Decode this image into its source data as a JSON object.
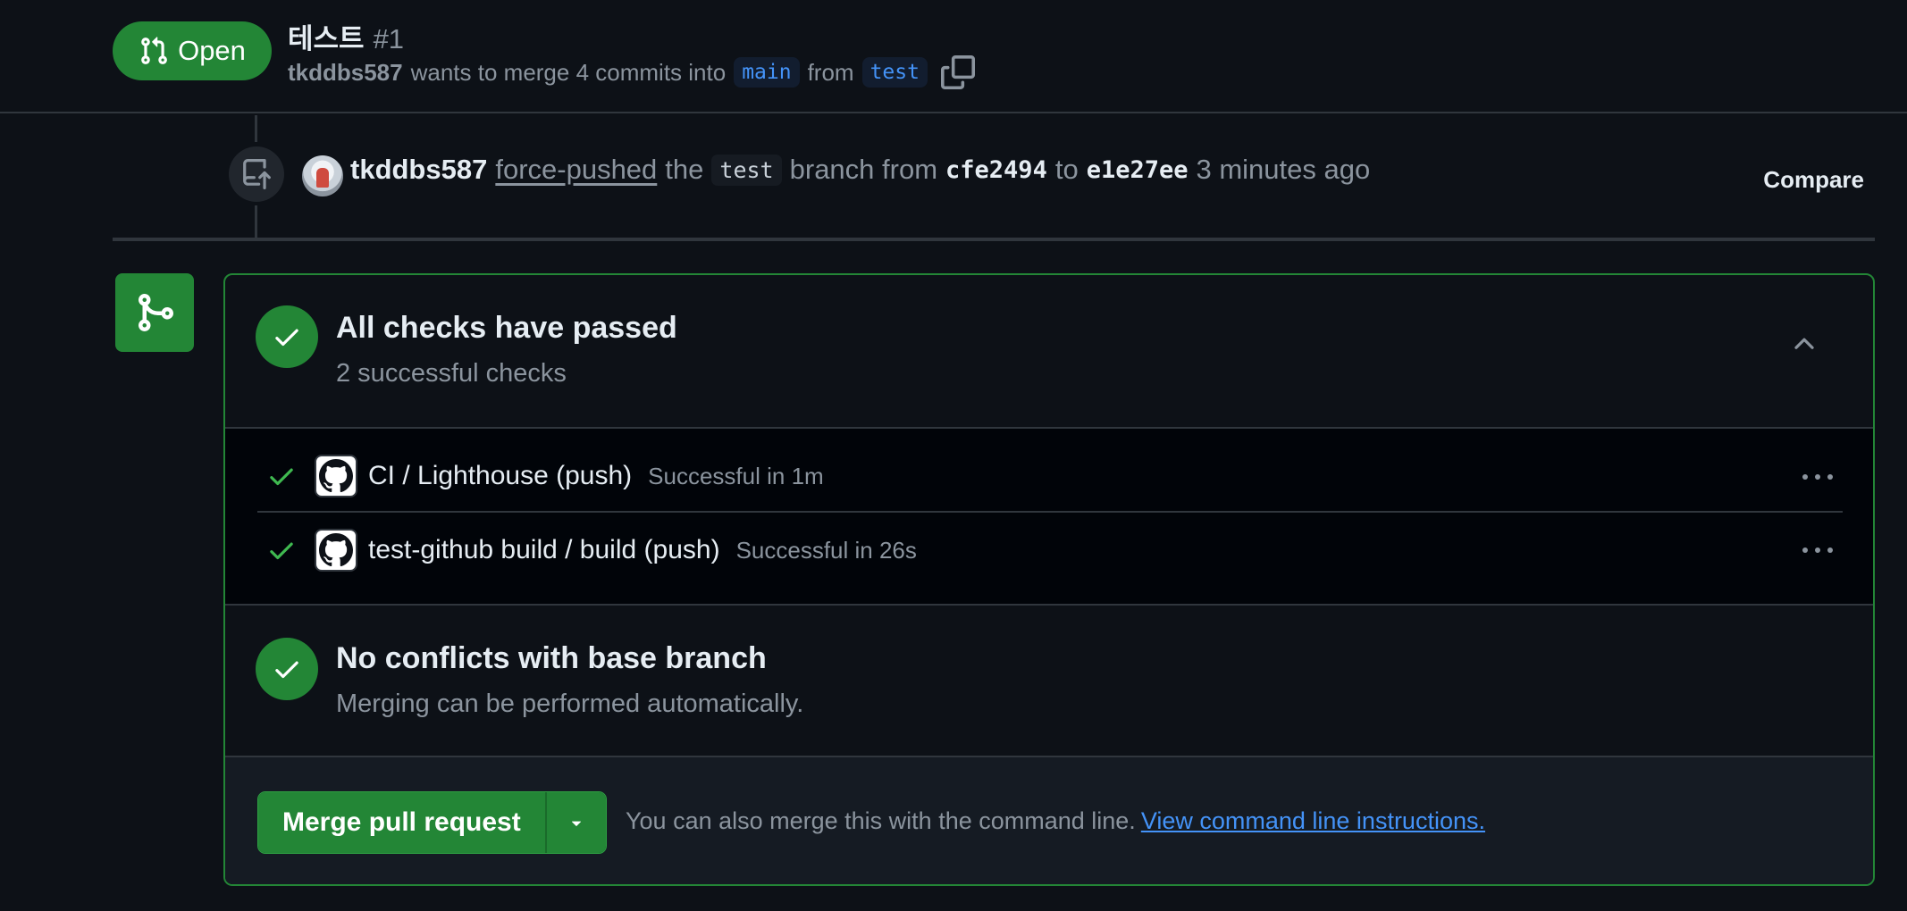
{
  "header": {
    "state_label": "Open",
    "title": "테스트",
    "number": "#1",
    "author": "tkddbs587",
    "meta_text": "wants to merge 4 commits into",
    "base_branch": "main",
    "from_text": "from",
    "head_branch": "test"
  },
  "event": {
    "author": "tkddbs587",
    "action": "force-pushed",
    "the_text": "the",
    "branch": "test",
    "branch_from_text": "branch from",
    "from_sha": "cfe2494",
    "to_text": "to",
    "to_sha": "e1e27ee",
    "time": "3 minutes ago",
    "compare_label": "Compare"
  },
  "checks": {
    "title": "All checks have passed",
    "subtitle": "2 successful checks",
    "items": [
      {
        "name": "CI / Lighthouse (push)",
        "status": "Successful in 1m"
      },
      {
        "name": "test-github build / build (push)",
        "status": "Successful in 26s"
      }
    ]
  },
  "conflicts": {
    "title": "No conflicts with base branch",
    "subtitle": "Merging can be performed automatically."
  },
  "merge": {
    "button_label": "Merge pull request",
    "hint_text": "You can also merge this with the command line.",
    "hint_link": "View command line instructions."
  },
  "colors": {
    "background": "#0d1117",
    "success": "#238636",
    "link": "#4493f8",
    "muted": "#8b949e"
  },
  "icons": {
    "state": "git-pull-request-icon",
    "copy": "copy-icon",
    "event": "repo-push-icon",
    "merge": "git-merge-icon",
    "check": "check-icon",
    "app": "github-mark-icon",
    "kebab": "kebab-horizontal-icon",
    "chevron": "chevron-up-icon",
    "dropdown": "triangle-down-icon"
  }
}
